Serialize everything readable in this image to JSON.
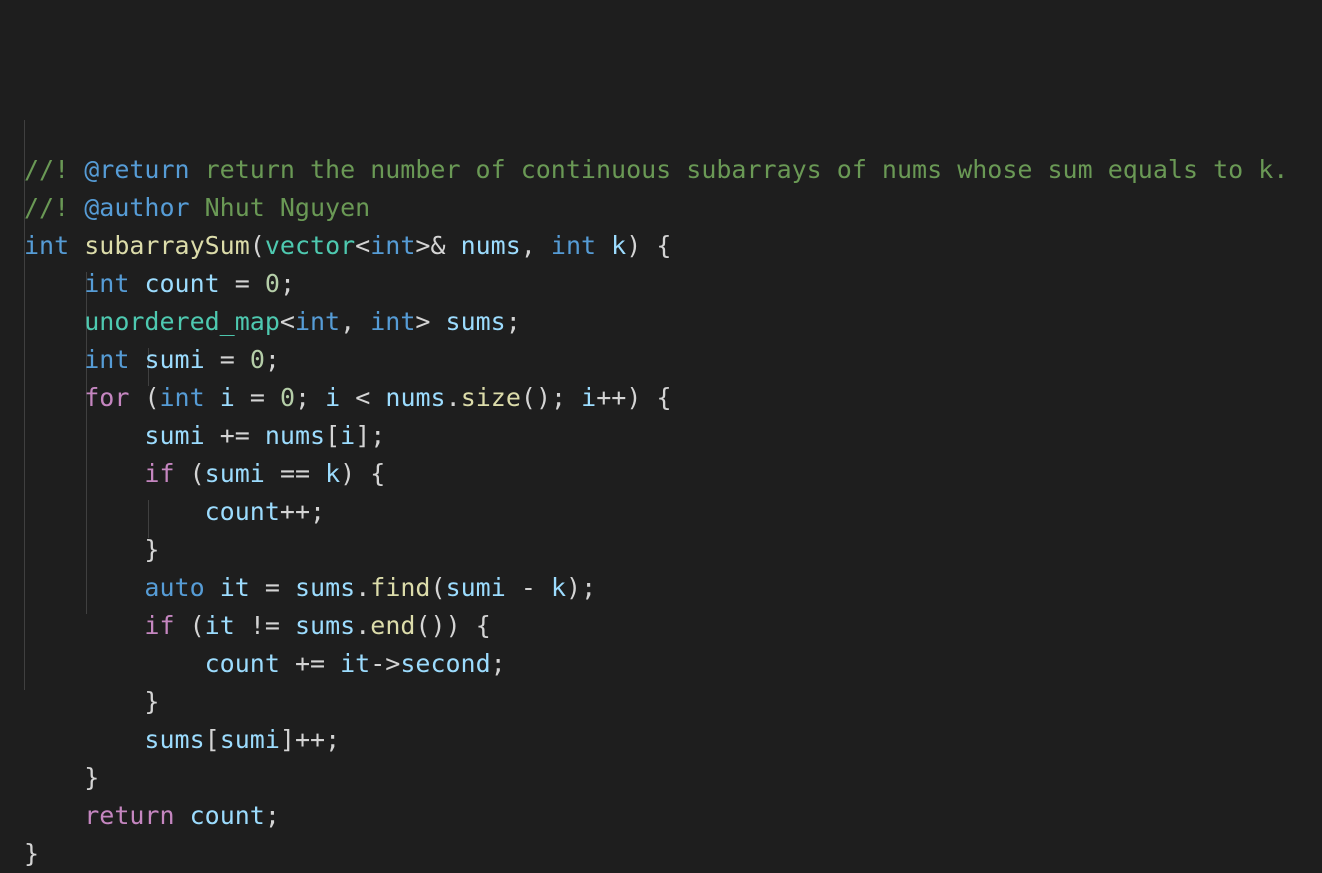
{
  "editor": {
    "theme": {
      "background": "#1e1e1e",
      "comment": "#6a9955",
      "keyword": "#569cd6",
      "control": "#c586c0",
      "function": "#dcdcaa",
      "type": "#4ec9b0",
      "variable": "#9cdcfe",
      "number": "#b5cea8",
      "default": "#d4d4d4"
    },
    "lines": [
      "//! @return return the number of continuous subarrays of nums whose sum equals to k.",
      "//! @author Nhut Nguyen",
      "int subarraySum(vector<int>& nums, int k) {",
      "    int count = 0;",
      "    unordered_map<int, int> sums;",
      "    int sumi = 0;",
      "    for (int i = 0; i < nums.size(); i++) {",
      "        sumi += nums[i];",
      "        if (sumi == k) {",
      "            count++;",
      "        }",
      "        auto it = sums.find(sumi - k);",
      "        if (it != sums.end()) {",
      "            count += it->second;",
      "        }",
      "        sums[sumi]++;",
      "    }",
      "    return count;",
      "}"
    ]
  }
}
